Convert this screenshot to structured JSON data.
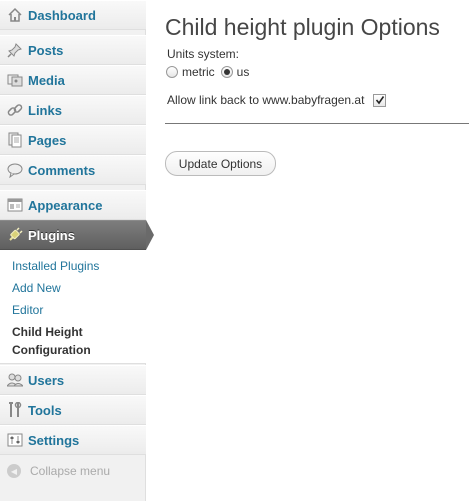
{
  "sidebar": {
    "items": [
      {
        "label": "Dashboard",
        "icon": "house-icon"
      },
      {
        "label": "Posts",
        "icon": "pushpin-icon"
      },
      {
        "label": "Media",
        "icon": "media-icon"
      },
      {
        "label": "Links",
        "icon": "chain-link-icon"
      },
      {
        "label": "Pages",
        "icon": "pages-icon"
      },
      {
        "label": "Comments",
        "icon": "speech-bubble-icon"
      },
      {
        "label": "Appearance",
        "icon": "appearance-icon"
      },
      {
        "label": "Plugins",
        "icon": "plug-icon",
        "current": true
      },
      {
        "label": "Users",
        "icon": "users-icon"
      },
      {
        "label": "Tools",
        "icon": "tools-icon"
      },
      {
        "label": "Settings",
        "icon": "settings-icon"
      }
    ],
    "submenu": {
      "installed": "Installed Plugins",
      "add_new": "Add New",
      "editor": "Editor",
      "current_line1": "Child Height",
      "current_line2": "Configuration"
    },
    "collapse_label": "Collapse menu"
  },
  "main": {
    "title": "Child height plugin Options",
    "units_label": "Units system:",
    "units_options": [
      "metric",
      "us"
    ],
    "units_selected": "us",
    "link_back_label": "Allow link back to www.babyfragen.at",
    "link_back_checked": true,
    "update_button": "Update Options"
  },
  "colors": {
    "link": "#21759b",
    "current_menu_bg": "#6a6a6a",
    "sidebar_bg": "#f1f1f1"
  }
}
